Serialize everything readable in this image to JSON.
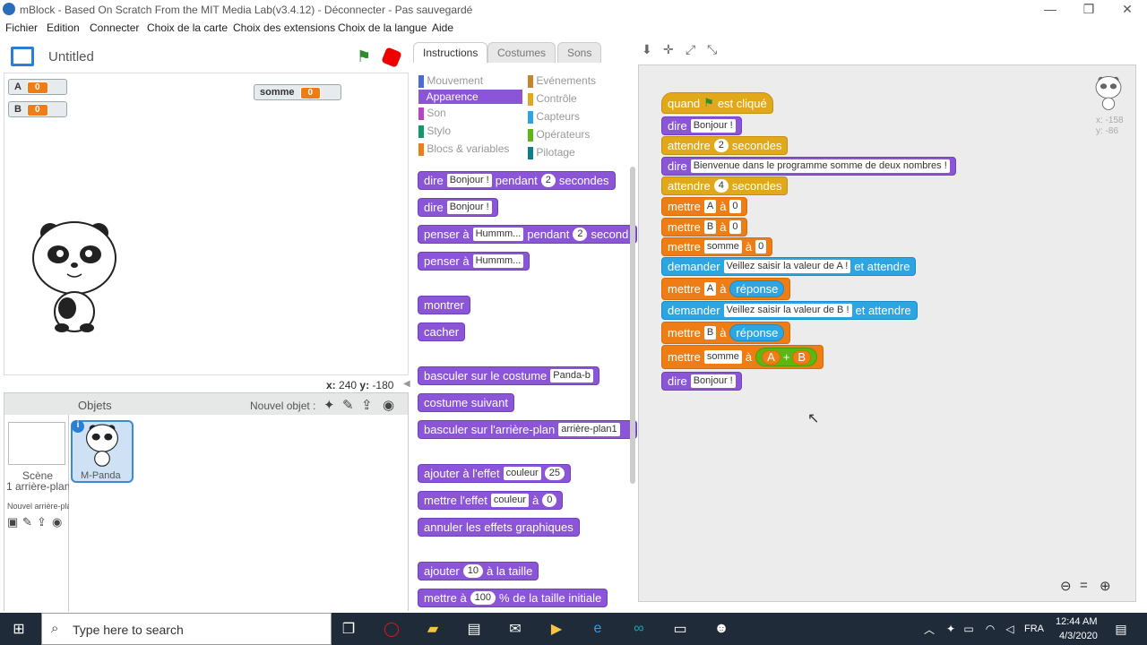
{
  "window": {
    "title": "mBlock - Based On Scratch From the MIT Media Lab(v3.4.12) - Déconnecter - Pas sauvegardé",
    "controls": [
      "—",
      "❐",
      "✕"
    ]
  },
  "menu": [
    "Fichier",
    "Edition",
    "Connecter",
    "Choix de la carte",
    "Choix des extensions",
    "Choix de la langue",
    "Aide"
  ],
  "stage": {
    "project_title": "Untitled",
    "coords": {
      "x_label": "x:",
      "x": "240",
      "y_label": "y:",
      "y": "-180"
    }
  },
  "variables": [
    {
      "name": "A",
      "value": "0"
    },
    {
      "name": "B",
      "value": "0"
    },
    {
      "name": "somme",
      "value": "0"
    }
  ],
  "sprites_pane": {
    "title": "Objets",
    "new_object": "Nouvel objet :",
    "scene_label": "Scène",
    "scene_sub": "1 arrière-plan",
    "new_backdrop": "Nouvel arrière-plan :",
    "sprite_name": "M-Panda"
  },
  "tabs": [
    "Instructions",
    "Costumes",
    "Sons"
  ],
  "categories_left": [
    {
      "label": "Mouvement",
      "color": "#4a6cd4"
    },
    {
      "label": "Apparence",
      "color": "#8a55d7",
      "active": true
    },
    {
      "label": "Son",
      "color": "#bb42c3"
    },
    {
      "label": "Stylo",
      "color": "#0e9a6c"
    },
    {
      "label": "Blocs & variables",
      "color": "#ee7d16"
    }
  ],
  "categories_right": [
    {
      "label": "Evénements",
      "color": "#c88330"
    },
    {
      "label": "Contrôle",
      "color": "#e1a91a"
    },
    {
      "label": "Capteurs",
      "color": "#2ca5e2"
    },
    {
      "label": "Opérateurs",
      "color": "#5cb712"
    },
    {
      "label": "Pilotage",
      "color": "#0d7f8c"
    }
  ],
  "palette": {
    "b1": [
      "dire",
      "Bonjour !",
      "pendant",
      "2",
      "secondes"
    ],
    "b2": [
      "dire",
      "Bonjour !"
    ],
    "b3": [
      "penser à",
      "Hummm...",
      "pendant",
      "2",
      "second"
    ],
    "b4": [
      "penser à",
      "Hummm..."
    ],
    "b5": "montrer",
    "b6": "cacher",
    "b7": [
      "basculer sur le costume",
      "Panda-b"
    ],
    "b8": "costume suivant",
    "b9": [
      "basculer sur l'arrière-plan",
      "arrière-plan1"
    ],
    "b10": [
      "ajouter à l'effet",
      "couleur",
      "25"
    ],
    "b11": [
      "mettre l'effet",
      "couleur",
      "à",
      "0"
    ],
    "b12": "annuler les effets graphiques",
    "b13": [
      "ajouter",
      "10",
      "à la taille"
    ],
    "b14": [
      "mettre à",
      "100",
      "% de la taille initiale"
    ]
  },
  "script": {
    "hat": [
      "quand",
      "est cliqué"
    ],
    "s1": [
      "dire",
      "Bonjour !"
    ],
    "s2": [
      "attendre",
      "2",
      "secondes"
    ],
    "s3": [
      "dire",
      "Bienvenue dans le  programme somme de deux nombres !"
    ],
    "s4": [
      "attendre",
      "4",
      "secondes"
    ],
    "s5": [
      "mettre",
      "A",
      "à",
      "0"
    ],
    "s6": [
      "mettre",
      "B",
      "à",
      "0"
    ],
    "s7": [
      "mettre",
      "somme",
      "à",
      "0"
    ],
    "s8": [
      "demander",
      "Veillez saisir la valeur de A !",
      "et attendre"
    ],
    "s9": [
      "mettre",
      "A",
      "à",
      "réponse"
    ],
    "s10": [
      "demander",
      "Veillez saisir la valeur de B !",
      "et attendre"
    ],
    "s11": [
      "mettre",
      "B",
      "à",
      "réponse"
    ],
    "s12": [
      "mettre",
      "somme",
      "à",
      "A",
      "+",
      "B"
    ],
    "s13": [
      "dire",
      "Bonjour !"
    ]
  },
  "sprite_coords": {
    "x": "x: -158",
    "y": "y: -86"
  },
  "taskbar": {
    "search_placeholder": "Type here to search",
    "lang": "FRA",
    "time": "12:44 AM",
    "date": "4/3/2020"
  }
}
